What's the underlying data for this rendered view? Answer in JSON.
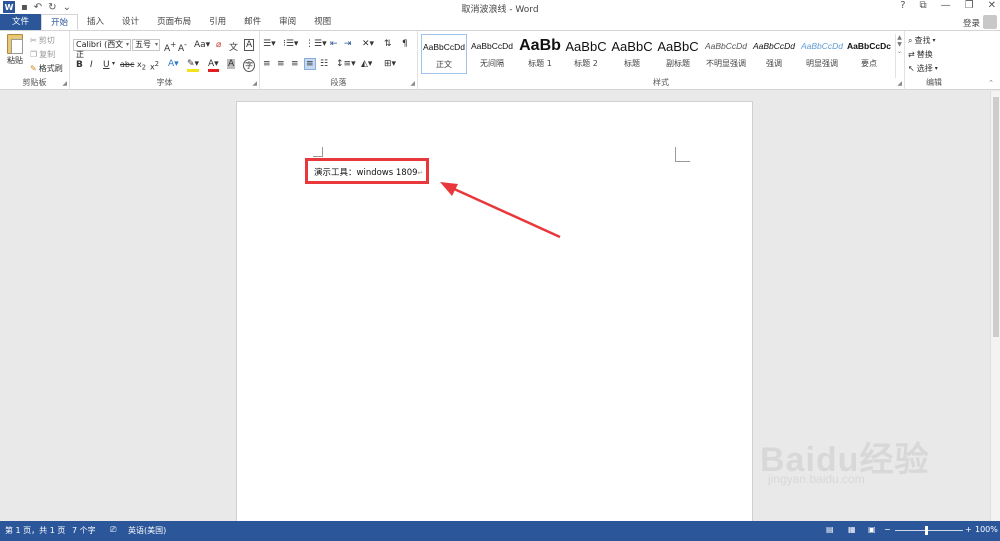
{
  "window": {
    "title": "取消波浪线 - Word",
    "controls": [
      "?",
      "⧉",
      "—",
      "❐",
      "✕"
    ]
  },
  "qat": {
    "undo": "↶",
    "redo": "↻",
    "more": "⌄"
  },
  "tabs": [
    "文件",
    "开始",
    "插入",
    "设计",
    "页面布局",
    "引用",
    "邮件",
    "审阅",
    "视图"
  ],
  "login_label": "登录",
  "clipboard": {
    "paste": "粘贴",
    "cut": "剪切",
    "copy": "复制",
    "format_painter": "格式刷",
    "label": "剪贴板"
  },
  "font": {
    "name": "Calibri (西文正",
    "size": "五号",
    "label": "字体"
  },
  "paragraph": {
    "label": "段落"
  },
  "styles": {
    "label": "样式",
    "items": [
      {
        "preview": "AaBbCcDd",
        "name": "正文"
      },
      {
        "preview": "AaBbCcDd",
        "name": "无间隔"
      },
      {
        "preview": "AaBb",
        "name": "标题 1"
      },
      {
        "preview": "AaBbC",
        "name": "标题 2"
      },
      {
        "preview": "AaBbC",
        "name": "标题"
      },
      {
        "preview": "AaBbC",
        "name": "副标题"
      },
      {
        "preview": "AaBbCcDd",
        "name": "不明显强调"
      },
      {
        "preview": "AaBbCcDd",
        "name": "强调"
      },
      {
        "preview": "AaBbCcDd",
        "name": "明显强调"
      },
      {
        "preview": "AaBbCcDc",
        "name": "要点"
      }
    ]
  },
  "editing": {
    "find": "查找",
    "replace": "替换",
    "select": "选择",
    "label": "编辑"
  },
  "document": {
    "text": "演示工具：windows 1809",
    "para_mark": "↵"
  },
  "status": {
    "page": "第 1 页，共 1 页",
    "words": "7 个字",
    "language": "英语(美国)",
    "zoom": "100%"
  },
  "watermark": {
    "logo": "Baidu经验",
    "url": "jingyan.baidu.com"
  },
  "colors": {
    "accent": "#2b579a",
    "highlight_box": "#e8383b"
  }
}
